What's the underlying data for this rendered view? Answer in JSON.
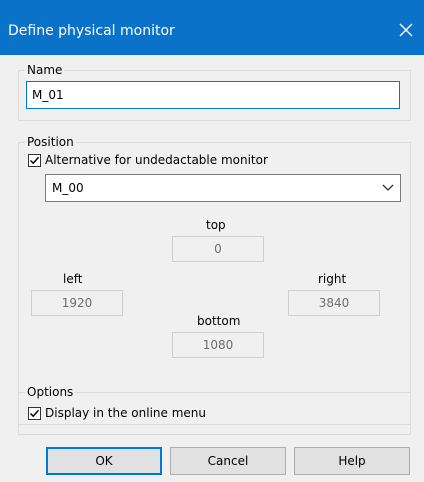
{
  "window": {
    "title": "Define physical monitor"
  },
  "name_group": {
    "legend": "Name",
    "value": "M_01"
  },
  "position_group": {
    "legend": "Position",
    "alt_checkbox_label": "Alternative for undedactable monitor",
    "alt_checked": true,
    "alt_selected": "M_00",
    "top_label": "top",
    "top_value": "0",
    "left_label": "left",
    "left_value": "1920",
    "right_label": "right",
    "right_value": "3840",
    "bottom_label": "bottom",
    "bottom_value": "1080"
  },
  "options_group": {
    "legend": "Options",
    "online_menu_label": "Display in the online menu",
    "online_menu_checked": true
  },
  "buttons": {
    "ok": "OK",
    "cancel": "Cancel",
    "help": "Help"
  },
  "icons": {
    "close": "close-icon",
    "check": "checkmark-icon",
    "dropdown": "chevron-down-icon"
  },
  "colors": {
    "titlebar": "#0a72c9",
    "focus": "#0078d7",
    "dialog_bg": "#f0f0f0"
  }
}
